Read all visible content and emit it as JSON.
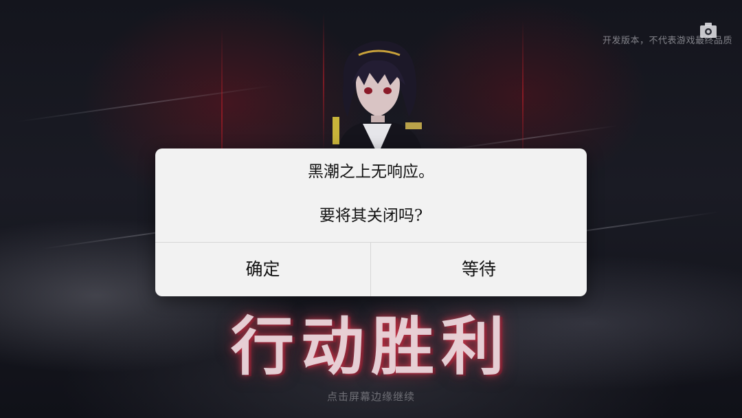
{
  "background": {
    "dev_notice": "开发版本，不代表游戏最终品质",
    "title_art": "行动胜利",
    "tap_hint": "点击屏幕边缘继续",
    "corner_icon": "screenshot-icon"
  },
  "dialog": {
    "message_line1": "黑潮之上无响应。",
    "message_line2": "要将其关闭吗?",
    "confirm_label": "确定",
    "wait_label": "等待"
  },
  "colors": {
    "dialog_bg": "#f2f2f2",
    "title_glow": "#dc3c50",
    "background": "#14151d"
  }
}
